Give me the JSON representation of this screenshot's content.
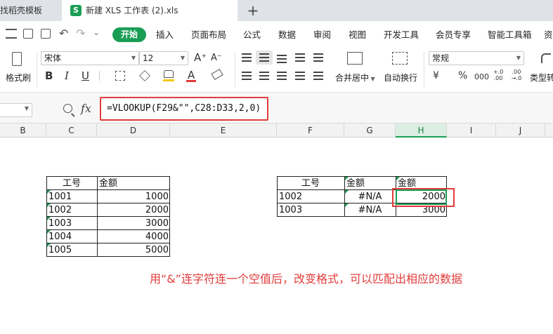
{
  "tabs": [
    {
      "label": "找稻壳模板"
    },
    {
      "label": "新建 XLS 工作表 (2).xls",
      "icon_text": "S"
    }
  ],
  "tab_controls": {
    "close": "×",
    "add": "+"
  },
  "menu": {
    "start": "开始",
    "items": [
      "插入",
      "页面布局",
      "公式",
      "数据",
      "审阅",
      "视图",
      "开发工具",
      "会员专享",
      "智能工具箱",
      "资"
    ]
  },
  "ribbon": {
    "format_painter": "格式刷",
    "font_name": "宋体",
    "font_size": "12",
    "bold": "B",
    "italic": "I",
    "underline": "U",
    "font_color": "A",
    "merge_center": "合并居中",
    "wrap_text": "自动换行",
    "number_format": "常规",
    "currency": "¥",
    "percent": "%",
    "thousands": "000",
    "dec_add": "+.0 .00",
    "dec_sub": ".00 →.0",
    "type_convert": "类型转"
  },
  "formula_bar": {
    "fx": "fx",
    "formula": "=VLOOKUP(F29&\"\",C28:D33,2,0)"
  },
  "columns": [
    "B",
    "C",
    "D",
    "E",
    "F",
    "G",
    "H",
    "I",
    "J"
  ],
  "left_table": {
    "headers": [
      "工号",
      "金额"
    ],
    "rows": [
      [
        "1001",
        "1000"
      ],
      [
        "1002",
        "2000"
      ],
      [
        "1003",
        "3000"
      ],
      [
        "1004",
        "4000"
      ],
      [
        "1005",
        "5000"
      ]
    ]
  },
  "right_table": {
    "headers": [
      "工号",
      "金额",
      "金额"
    ],
    "rows": [
      [
        "1002",
        "#N/A",
        "2000"
      ],
      [
        "1003",
        "#N/A",
        "3000"
      ]
    ]
  },
  "annotation": "用“&”连字符连一个空值后，改变格式，可以匹配出相应的数据",
  "colors": {
    "accent": "#1a9e55",
    "highlight": "#e23b3b"
  }
}
